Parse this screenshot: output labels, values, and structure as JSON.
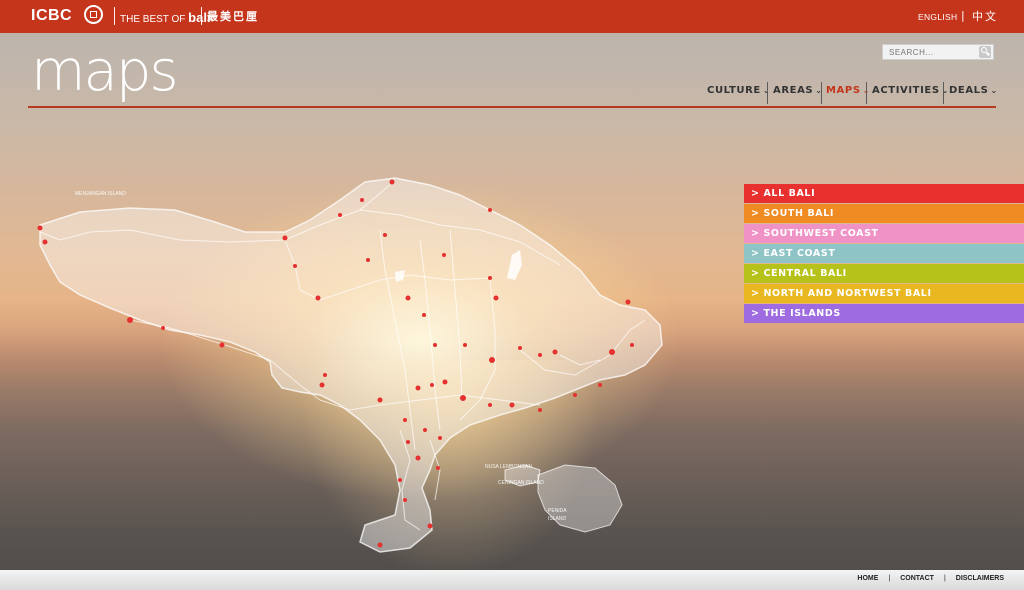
{
  "header": {
    "logo_text": "ICBC",
    "tagline_prefix": "THE BEST OF",
    "tagline_brand": "bali",
    "tagline_cn": "最美巴厘",
    "lang_english": "ENGLISH",
    "lang_separator": "|",
    "lang_chinese": "中文"
  },
  "search": {
    "placeholder": "SEARCH..."
  },
  "page": {
    "title": "maps"
  },
  "nav": {
    "items": [
      {
        "label": "CULTURE",
        "active": false
      },
      {
        "label": "AREAS",
        "active": false
      },
      {
        "label": "MAPS",
        "active": true
      },
      {
        "label": "ACTIVITIES",
        "active": false
      },
      {
        "label": "DEALS",
        "active": false
      }
    ],
    "chevron": "⌄"
  },
  "regions": {
    "items": [
      {
        "label": "> ALL BALI",
        "color": "#e8302f"
      },
      {
        "label": "> SOUTH BALI",
        "color": "#f08a22"
      },
      {
        "label": "> SOUTHWEST COAST",
        "color": "#ef93c6"
      },
      {
        "label": "> EAST COAST",
        "color": "#8fc4c6"
      },
      {
        "label": "> CENTRAL BALI",
        "color": "#b6c21a"
      },
      {
        "label": "> NORTH AND NORTWEST BALI",
        "color": "#e9b820"
      },
      {
        "label": "> THE ISLANDS",
        "color": "#9e6ce0"
      }
    ]
  },
  "map": {
    "labels": {
      "menjangan": "MENJANGAN ISLAND",
      "nusa_lembongan": "NUSA LEMBONGAN",
      "nusa_ceningan": "CENINGAN ISLAND",
      "nusa_penida": "PENIDA",
      "island": "ISLAND"
    }
  },
  "footer": {
    "home": "HOME",
    "contact": "CONTACT",
    "disclaimers": "DISCLAIMERS",
    "separator": "|"
  },
  "colors": {
    "brand_red": "#c4351c",
    "title_rule": "#b43a1f"
  }
}
